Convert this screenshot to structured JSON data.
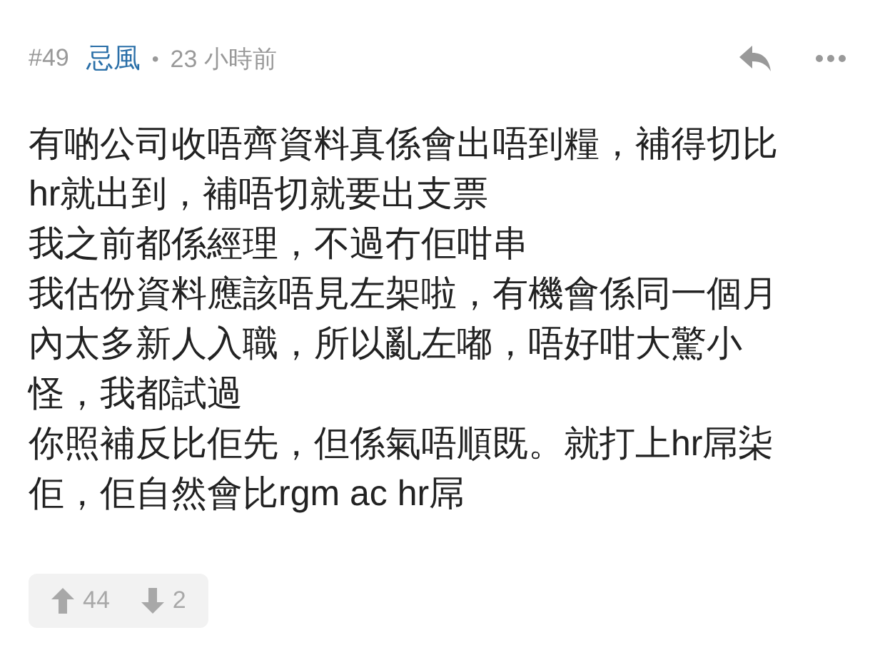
{
  "post": {
    "number": "#49",
    "author": "忌風",
    "separator": "•",
    "time": "23 小時前"
  },
  "paragraphs": [
    "有啲公司收唔齊資料真係會出唔到糧，補得切比hr就出到，補唔切就要出支票",
    "我之前都係經理，不過冇佢咁串",
    "我估份資料應該唔見左架啦，有機會係同一個月內太多新人入職，所以亂左嘟，唔好咁大驚小怪，我都試過",
    "你照補反比佢先，但係氣唔順既。就打上hr屌柒佢，佢自然會比rgm ac hr屌"
  ],
  "votes": {
    "up": "44",
    "down": "2"
  }
}
